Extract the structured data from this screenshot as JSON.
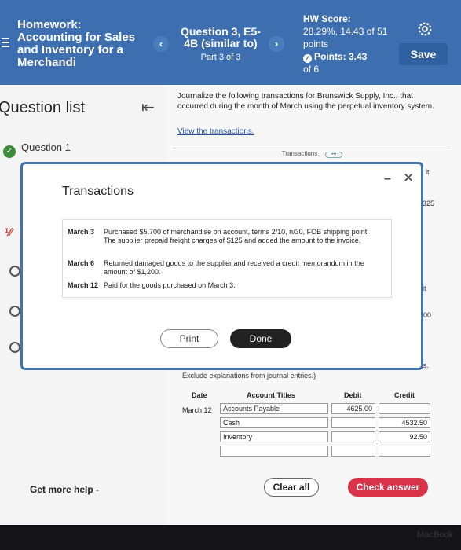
{
  "header": {
    "assignment_title": "Homework: Accounting for Sales and Inventory for a Merchandi",
    "question_label": "Question 3, E5-4B (similar to)",
    "part_label": "Part 3 of 3",
    "hw_score_label": "HW Score:",
    "hw_score_value": "28.29%, 14.43 of 51 points",
    "points_value": "Points: 3.43",
    "points_of": "of 6",
    "save_label": "Save"
  },
  "left_panel": {
    "title": "Question list",
    "question1": "Question 1",
    "get_help": "Get more help -"
  },
  "main": {
    "instructions": "Journalize the following transactions for Brunswick Supply, Inc., that occurred during the month of March using the perpetual inventory system.",
    "view_link": "View the transactions.",
    "tab_label": "Transactions",
    "exclude_note": "Exclude explanations from journal entries.)",
    "journal": {
      "headers": [
        "Date",
        "Account Titles",
        "Debit",
        "Credit"
      ],
      "date": "March 12",
      "rows": [
        {
          "account": "Accounts Payable",
          "debit": "4625.00",
          "credit": ""
        },
        {
          "account": "Cash",
          "debit": "",
          "credit": "4532.50"
        },
        {
          "account": "Inventory",
          "debit": "",
          "credit": "92.50"
        },
        {
          "account": "",
          "debit": "",
          "credit": ""
        }
      ]
    },
    "clear_all": "Clear all",
    "check_answer": "Check answer",
    "right_edge": [
      "it",
      "325",
      "it",
      "200",
      "its."
    ]
  },
  "modal": {
    "title": "Transactions",
    "transactions": [
      {
        "date": "March 3",
        "text": "Purchased $5,700 of merchandise on account, terms 2/10, n/30, FOB shipping point. The supplier prepaid freight charges of $125 and added the amount to the invoice."
      },
      {
        "date": "March 6",
        "text": "Returned damaged goods to the supplier and received a credit memorandum in the amount of $1,200."
      },
      {
        "date": "March 12",
        "text": "Paid for the goods purchased on March 3."
      }
    ],
    "print_label": "Print",
    "done_label": "Done"
  },
  "footer": {
    "brand": "MacBook"
  }
}
